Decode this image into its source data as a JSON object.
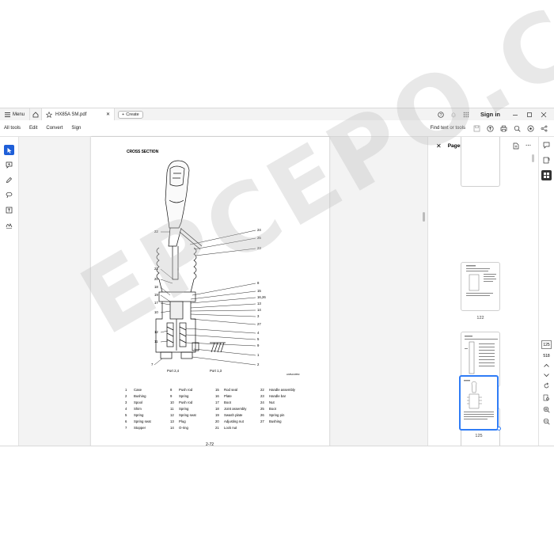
{
  "titlebar": {
    "menu_label": "Menu",
    "tab_title": "HX85A SM.pdf",
    "create_label": "Create",
    "signin_label": "Sign in"
  },
  "toolbar": {
    "items": [
      "All tools",
      "Edit",
      "Convert",
      "Sign"
    ],
    "find_label": "Find text or tools"
  },
  "document": {
    "section_title": "CROSS SECTION",
    "page_number": "2-72",
    "figure_code": "HX85A2VB5D",
    "port_left": "Port 2,4",
    "port_right": "Port 1,3",
    "callouts_left": [
      "22",
      "21",
      "20",
      "18",
      "19",
      "17",
      "10",
      "12",
      "11"
    ],
    "callouts_right": [
      "24",
      "25",
      "23",
      "8",
      "15",
      "16,26",
      "13",
      "14",
      "3",
      "27",
      "4",
      "5",
      "9",
      "1",
      "2"
    ],
    "callout_bottom": "7",
    "legend": [
      {
        "n": "1",
        "t": "Case"
      },
      {
        "n": "8",
        "t": "Push rod"
      },
      {
        "n": "15",
        "t": "Rod seal"
      },
      {
        "n": "22",
        "t": "Handle assembly"
      },
      {
        "n": "2",
        "t": "Bushing"
      },
      {
        "n": "9",
        "t": "Spring"
      },
      {
        "n": "16",
        "t": "Plate"
      },
      {
        "n": "23",
        "t": "Handle bar"
      },
      {
        "n": "3",
        "t": "Spool"
      },
      {
        "n": "10",
        "t": "Push rod"
      },
      {
        "n": "17",
        "t": "Boot"
      },
      {
        "n": "24",
        "t": "Nut"
      },
      {
        "n": "4",
        "t": "Shim"
      },
      {
        "n": "11",
        "t": "Spring"
      },
      {
        "n": "18",
        "t": "Joint assembly"
      },
      {
        "n": "25",
        "t": "Boot"
      },
      {
        "n": "5",
        "t": "Spring"
      },
      {
        "n": "12",
        "t": "Spring seat"
      },
      {
        "n": "19",
        "t": "Swash plate"
      },
      {
        "n": "26",
        "t": "Spring pin"
      },
      {
        "n": "6",
        "t": "Spring seat"
      },
      {
        "n": "13",
        "t": "Plug"
      },
      {
        "n": "20",
        "t": "Adjusting nut"
      },
      {
        "n": "27",
        "t": "Bushing"
      },
      {
        "n": "7",
        "t": "Stopper"
      },
      {
        "n": "14",
        "t": "O-ring"
      },
      {
        "n": "21",
        "t": "Lock nut"
      },
      {
        "n": "",
        "t": ""
      }
    ]
  },
  "pages_panel": {
    "title": "Pages",
    "thumbnails": [
      {
        "label": "122"
      },
      {
        "label": "123"
      },
      {
        "label": "124"
      },
      {
        "label": "125"
      }
    ]
  },
  "page_nav": {
    "current": "125",
    "total": "518"
  },
  "watermark": "EPCEPO.COM"
}
